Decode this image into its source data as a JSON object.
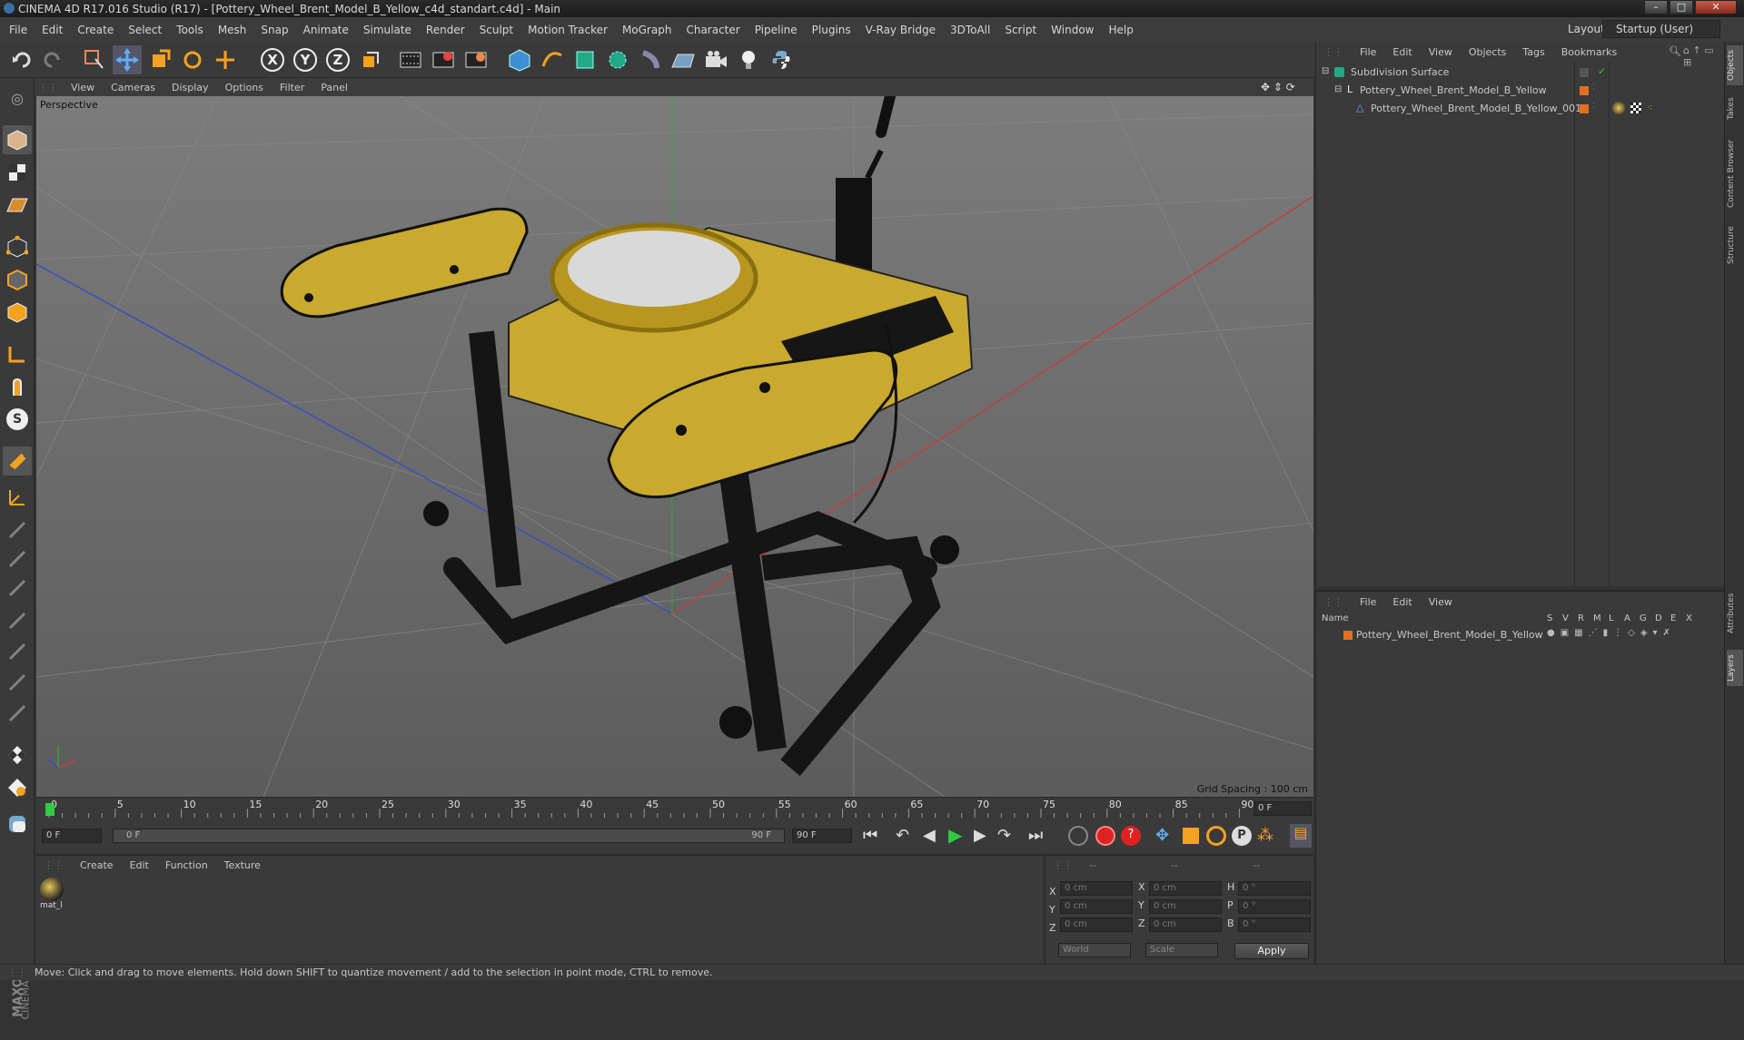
{
  "window": {
    "title": "CINEMA 4D R17.016 Studio (R17) - [Pottery_Wheel_Brent_Model_B_Yellow_c4d_standart.c4d] - Main"
  },
  "menubar": {
    "items": [
      "File",
      "Edit",
      "Create",
      "Select",
      "Tools",
      "Mesh",
      "Snap",
      "Animate",
      "Simulate",
      "Render",
      "Sculpt",
      "Motion Tracker",
      "MoGraph",
      "Character",
      "Pipeline",
      "Plugins",
      "V-Ray Bridge",
      "3DToAll",
      "Script",
      "Window",
      "Help"
    ],
    "layout_label": "Layout:",
    "layout_value": "Startup (User)"
  },
  "toolbar": {
    "axis": [
      "X",
      "Y",
      "Z"
    ]
  },
  "viewport": {
    "menu": [
      "View",
      "Cameras",
      "Display",
      "Options",
      "Filter",
      "Panel"
    ],
    "label": "Perspective",
    "grid_spacing": "Grid Spacing : 100 cm"
  },
  "objects_panel": {
    "menu": [
      "File",
      "Edit",
      "View",
      "Objects",
      "Tags",
      "Bookmarks"
    ],
    "items": [
      {
        "name": "Subdivision Surface"
      },
      {
        "name": "Pottery_Wheel_Brent_Model_B_Yellow"
      },
      {
        "name": "Pottery_Wheel_Brent_Model_B_Yellow_001"
      }
    ]
  },
  "layers_panel": {
    "menu": [
      "File",
      "Edit",
      "View"
    ],
    "name_header": "Name",
    "col_headers": [
      "S",
      "V",
      "R",
      "M",
      "L",
      "A",
      "G",
      "D",
      "E",
      "X"
    ],
    "layer": "Pottery_Wheel_Brent_Model_B_Yellow"
  },
  "right_tabs": [
    "Objects",
    "Takes",
    "Content Browser",
    "Structure",
    "Attributes",
    "Layers"
  ],
  "timeline": {
    "ticks": [
      "0",
      "5",
      "10",
      "15",
      "20",
      "25",
      "30",
      "35",
      "40",
      "45",
      "50",
      "55",
      "60",
      "65",
      "70",
      "75",
      "80",
      "85",
      "90"
    ],
    "current_frame": "0 F",
    "start": "0 F",
    "range_start": "0 F",
    "range_end": "90 F",
    "end": "90 F"
  },
  "materials": {
    "menu": [
      "Create",
      "Edit",
      "Function",
      "Texture"
    ],
    "items": [
      {
        "name": "mat_l"
      }
    ]
  },
  "coords": {
    "headers": [
      "--",
      "--",
      "--"
    ],
    "rows": [
      {
        "a": "X",
        "av": "0 cm",
        "b": "X",
        "bv": "0 cm",
        "c": "H",
        "cv": "0 °"
      },
      {
        "a": "Y",
        "av": "0 cm",
        "b": "Y",
        "bv": "0 cm",
        "c": "P",
        "cv": "0 °"
      },
      {
        "a": "Z",
        "av": "0 cm",
        "b": "Z",
        "bv": "0 cm",
        "c": "B",
        "cv": "0 °"
      }
    ],
    "world": "World",
    "scale": "Scale",
    "apply": "Apply"
  },
  "status": "Move: Click and drag to move elements. Hold down SHIFT to quantize movement / add to the selection in point mode, CTRL to remove.",
  "brand": {
    "line1": "MAXON",
    "line2": "CINEMA 4D"
  }
}
